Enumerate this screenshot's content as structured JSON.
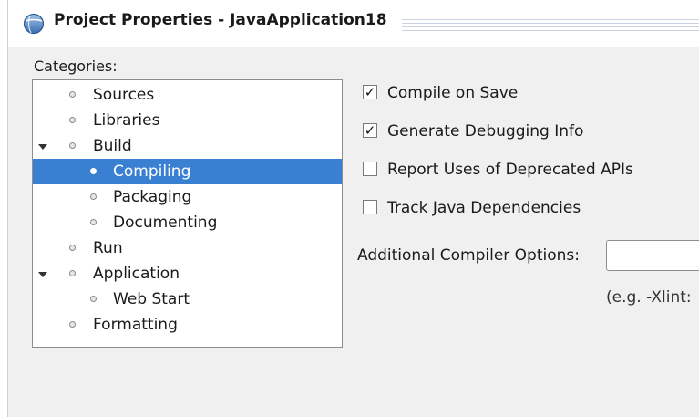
{
  "window": {
    "title": "Project Properties - JavaApplication18",
    "icon": "globe-icon"
  },
  "categories": {
    "label": "Categories:",
    "items": [
      {
        "label": "Sources",
        "level": 1,
        "expanded": false,
        "selected": false
      },
      {
        "label": "Libraries",
        "level": 1,
        "expanded": false,
        "selected": false
      },
      {
        "label": "Build",
        "level": 1,
        "expanded": true,
        "selected": false
      },
      {
        "label": "Compiling",
        "level": 2,
        "expanded": false,
        "selected": true
      },
      {
        "label": "Packaging",
        "level": 2,
        "expanded": false,
        "selected": false
      },
      {
        "label": "Documenting",
        "level": 2,
        "expanded": false,
        "selected": false
      },
      {
        "label": "Run",
        "level": 1,
        "expanded": false,
        "selected": false
      },
      {
        "label": "Application",
        "level": 1,
        "expanded": true,
        "selected": false
      },
      {
        "label": "Web Start",
        "level": 2,
        "expanded": false,
        "selected": false
      },
      {
        "label": "Formatting",
        "level": 1,
        "expanded": false,
        "selected": false
      }
    ]
  },
  "compiling": {
    "options": [
      {
        "label": "Compile on Save",
        "checked": true
      },
      {
        "label": "Generate Debugging Info",
        "checked": true
      },
      {
        "label": "Report Uses of Deprecated APIs",
        "checked": false
      },
      {
        "label": "Track Java Dependencies",
        "checked": false
      }
    ],
    "additional_options_label": "Additional Compiler Options:",
    "additional_options_value": "",
    "hint": "(e.g. -Xlint:"
  },
  "colors": {
    "selection": "#3a80d2",
    "dialog_background": "#f0f0f0"
  }
}
